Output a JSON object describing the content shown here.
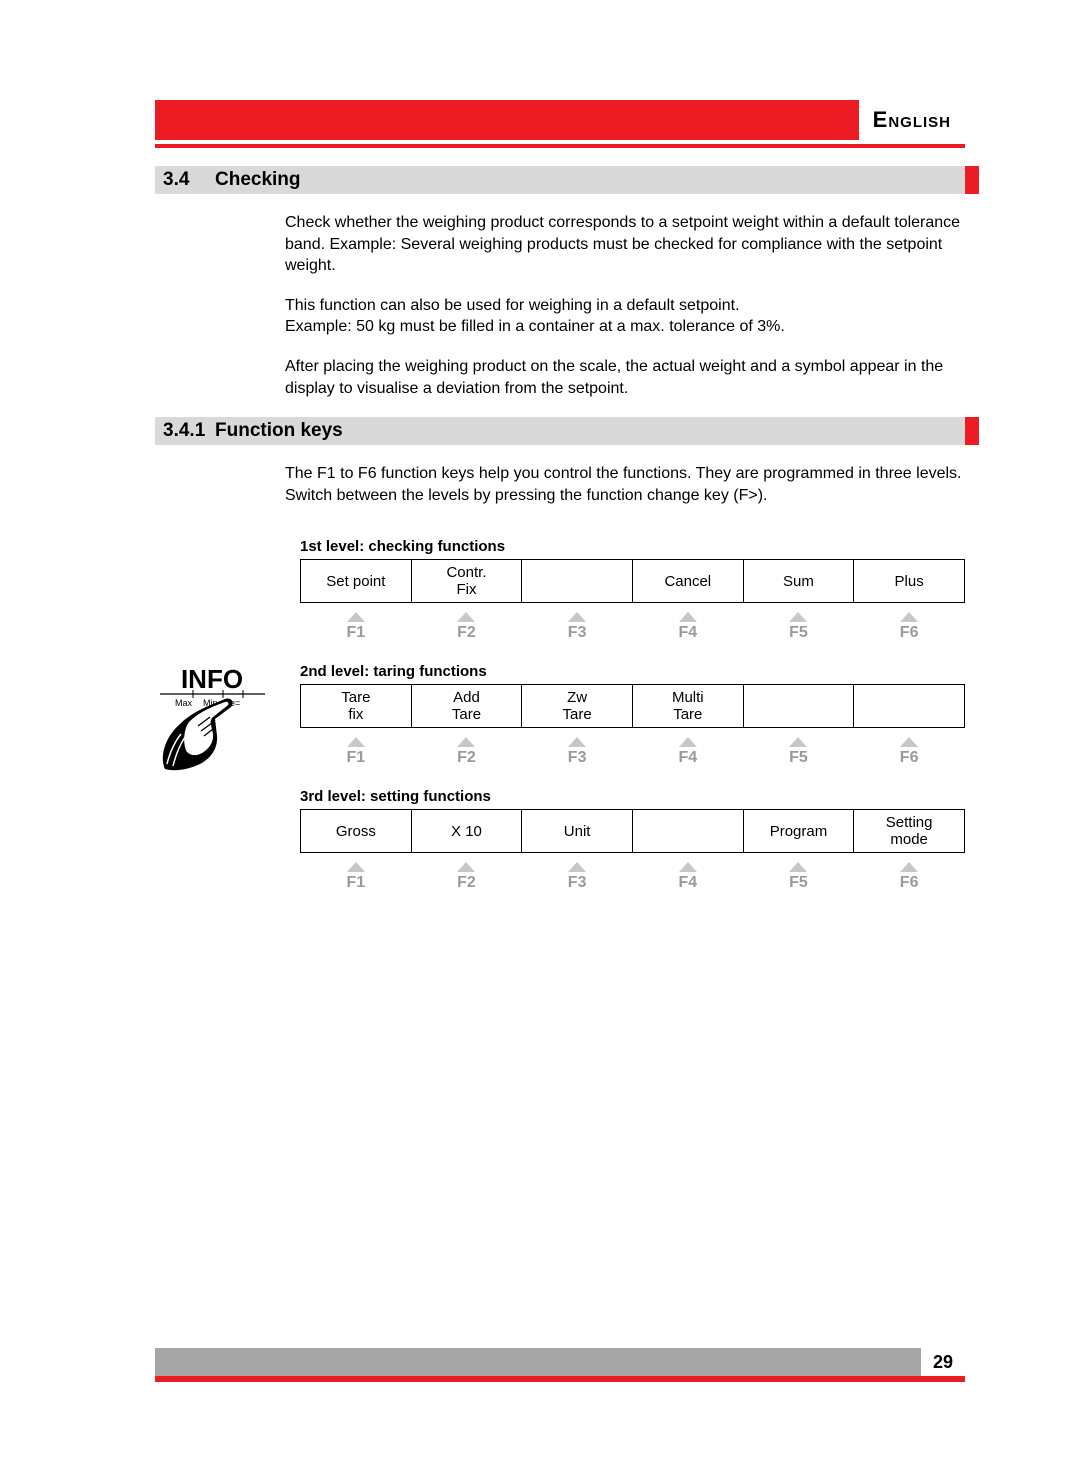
{
  "language": "English",
  "section": {
    "num": "3.4",
    "title": "Checking"
  },
  "para1": "Check whether the weighing product corresponds to a setpoint weight within a default tolerance band. Example: Several weighing products must be checked for compliance with the setpoint weight.",
  "para2a": "This function can also be used for weighing in a default setpoint.",
  "para2b": "Example: 50 kg must be filled in a container at a max. tolerance of 3%.",
  "para3": "After placing the weighing product on the scale, the actual weight and a symbol appear in the display to visualise a deviation from the setpoint.",
  "subsection": {
    "num": "3.4.1",
    "title": "Function keys"
  },
  "fkeys_intro": "The F1 to F6 function keys help you control the functions. They are programmed in three levels. Switch between the levels by pressing the function change key (F>).",
  "info_label": "INFO",
  "info_sub": "Max Min e=",
  "level1": {
    "title": "1st level: checking functions",
    "cells": [
      "Set point",
      "Contr.\nFix",
      "",
      "Cancel",
      "Sum",
      "Plus"
    ]
  },
  "level2": {
    "title": "2nd level: taring functions",
    "cells": [
      "Tare\nfix",
      "Add\nTare",
      "Zw\nTare",
      "Multi\nTare",
      "",
      ""
    ]
  },
  "level3": {
    "title": "3rd level: setting functions",
    "cells": [
      "Gross",
      "X 10",
      "Unit",
      "",
      "Program",
      "Setting\nmode"
    ]
  },
  "fkey_labels": [
    "F1",
    "F2",
    "F3",
    "F4",
    "F5",
    "F6"
  ],
  "page_number": "29"
}
